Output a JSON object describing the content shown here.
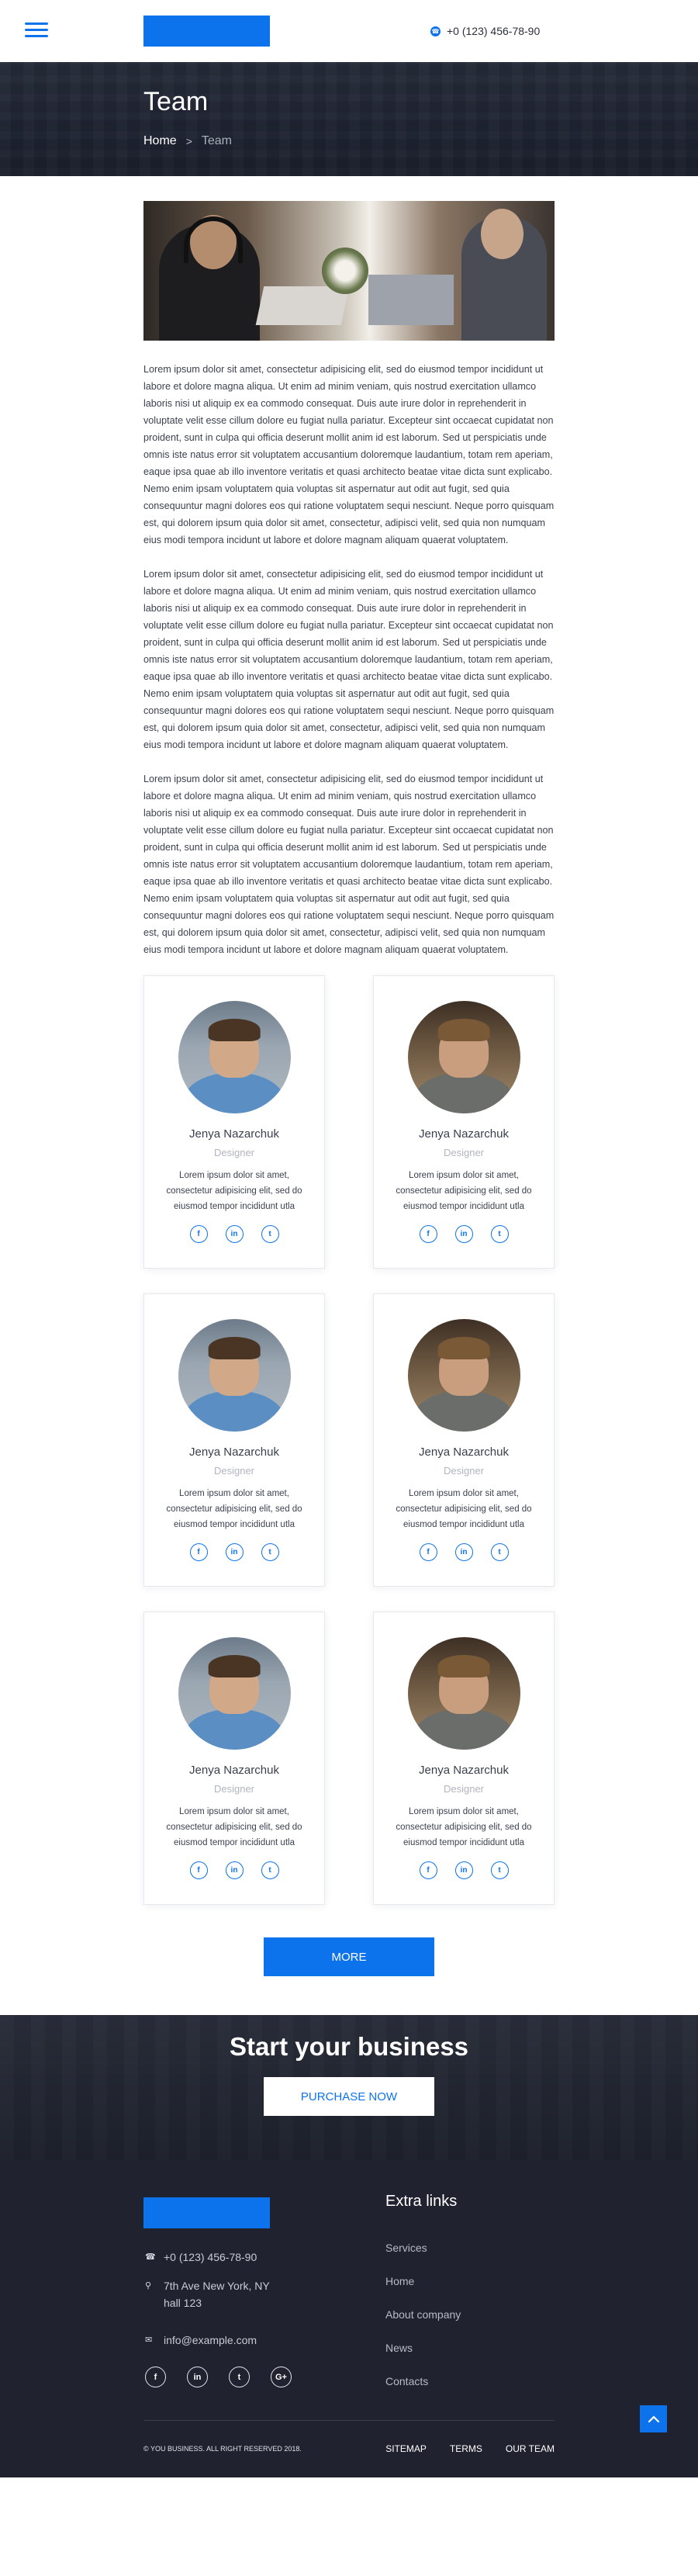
{
  "header": {
    "menu_icon": "hamburger-menu-icon",
    "phone": "+0 (123) 456-78-90",
    "phone_icon": "phone-icon",
    "accent_color": "#0d73ec"
  },
  "hero": {
    "title": "Team",
    "breadcrumb": {
      "home": "Home",
      "separator": ">",
      "current": "Team"
    }
  },
  "article": {
    "paragraphs": [
      "Lorem ipsum dolor sit amet, consectetur adipisicing elit, sed do eiusmod tempor incididunt ut labore et dolore magna aliqua. Ut enim ad minim veniam, quis nostrud exercitation ullamco laboris nisi ut aliquip ex ea commodo consequat. Duis aute irure dolor in reprehenderit in voluptate velit esse cillum dolore eu fugiat nulla pariatur. Excepteur sint occaecat cupidatat non proident, sunt in culpa qui officia deserunt mollit anim id est laborum. Sed ut perspiciatis unde omnis iste natus error sit voluptatem accusantium doloremque laudantium, totam rem aperiam, eaque ipsa quae ab illo inventore veritatis et quasi architecto beatae vitae dicta sunt explicabo. Nemo enim ipsam voluptatem quia voluptas sit aspernatur aut odit aut fugit, sed quia consequuntur magni dolores eos qui ratione voluptatem sequi nesciunt. Neque porro quisquam est, qui dolorem ipsum quia dolor sit amet, consectetur, adipisci velit, sed quia non numquam eius modi tempora incidunt ut labore et dolore magnam aliquam quaerat voluptatem.",
      "Lorem ipsum dolor sit amet, consectetur adipisicing elit, sed do eiusmod tempor incididunt ut labore et dolore magna aliqua. Ut enim ad minim veniam, quis nostrud exercitation ullamco laboris nisi ut aliquip ex ea commodo consequat. Duis aute irure dolor in reprehenderit in voluptate velit esse cillum dolore eu fugiat nulla pariatur. Excepteur sint occaecat cupidatat non proident, sunt in culpa qui officia deserunt mollit anim id est laborum. Sed ut perspiciatis unde omnis iste natus error sit voluptatem accusantium doloremque laudantium, totam rem aperiam, eaque ipsa quae ab illo inventore veritatis et quasi architecto beatae vitae dicta sunt explicabo. Nemo enim ipsam voluptatem quia voluptas sit aspernatur aut odit aut fugit, sed quia consequuntur magni dolores eos qui ratione voluptatem sequi nesciunt. Neque porro quisquam est, qui dolorem ipsum quia dolor sit amet, consectetur, adipisci velit, sed quia non numquam eius modi tempora incidunt ut labore et dolore magnam aliquam quaerat voluptatem.",
      "Lorem ipsum dolor sit amet, consectetur adipisicing elit, sed do eiusmod tempor incididunt ut labore et dolore magna aliqua. Ut enim ad minim veniam, quis nostrud exercitation ullamco laboris nisi ut aliquip ex ea commodo consequat. Duis aute irure dolor in reprehenderit in voluptate velit esse cillum dolore eu fugiat nulla pariatur. Excepteur sint occaecat cupidatat non proident, sunt in culpa qui officia deserunt mollit anim id est laborum. Sed ut perspiciatis unde omnis iste natus error sit voluptatem accusantium doloremque laudantium, totam rem aperiam, eaque ipsa quae ab illo inventore veritatis et quasi architecto beatae vitae dicta sunt explicabo. Nemo enim ipsam voluptatem quia voluptas sit aspernatur aut odit aut fugit, sed quia consequuntur magni dolores eos qui ratione voluptatem sequi nesciunt. Neque porro quisquam est, qui dolorem ipsum quia dolor sit amet, consectetur, adipisci velit, sed quia non numquam eius modi tempora incidunt ut labore et dolore magnam aliquam quaerat voluptatem."
    ]
  },
  "team": {
    "members": [
      {
        "name": "Jenya Nazarchuk",
        "role": "Designer",
        "desc": "Lorem ipsum dolor sit amet, consectetur adipisicing elit, sed do eiusmod tempor incididunt utla",
        "socials": [
          "f",
          "in",
          "t"
        ]
      },
      {
        "name": "Jenya Nazarchuk",
        "role": "Designer",
        "desc": "Lorem ipsum dolor sit amet, consectetur adipisicing elit, sed do eiusmod tempor incididunt utla",
        "socials": [
          "f",
          "in",
          "t"
        ]
      },
      {
        "name": "Jenya Nazarchuk",
        "role": "Designer",
        "desc": "Lorem ipsum dolor sit amet, consectetur adipisicing elit, sed do eiusmod tempor incididunt utla",
        "socials": [
          "f",
          "in",
          "t"
        ]
      },
      {
        "name": "Jenya Nazarchuk",
        "role": "Designer",
        "desc": "Lorem ipsum dolor sit amet, consectetur adipisicing elit, sed do eiusmod tempor incididunt utla",
        "socials": [
          "f",
          "in",
          "t"
        ]
      },
      {
        "name": "Jenya Nazarchuk",
        "role": "Designer",
        "desc": "Lorem ipsum dolor sit amet, consectetur adipisicing elit, sed do eiusmod tempor incididunt utla",
        "socials": [
          "f",
          "in",
          "t"
        ]
      },
      {
        "name": "Jenya Nazarchuk",
        "role": "Designer",
        "desc": "Lorem ipsum dolor sit amet, consectetur adipisicing elit, sed do eiusmod tempor incididunt utla",
        "socials": [
          "f",
          "in",
          "t"
        ]
      }
    ],
    "more_label": "MORE"
  },
  "cta": {
    "title": "Start your business",
    "button_label": "PURCHASE NOW"
  },
  "footer": {
    "phone": "+0 (123) 456-78-90",
    "address_line1": "7th Ave New York, NY",
    "address_line2": "hall 123",
    "email": "info@example.com",
    "social": [
      "f",
      "in",
      "t",
      "G+"
    ],
    "extra_title": "Extra links",
    "extra_links": [
      "Services",
      "Home",
      "About company",
      "News",
      "Contacts"
    ],
    "copyright": "© YOU BUSINESS. ALL RIGHT RESERVED 2018.",
    "bottom_nav": [
      "SITEMAP",
      "TERMS",
      "OUR TEAM"
    ],
    "scroll_top_icon": "arrow-up-icon"
  }
}
